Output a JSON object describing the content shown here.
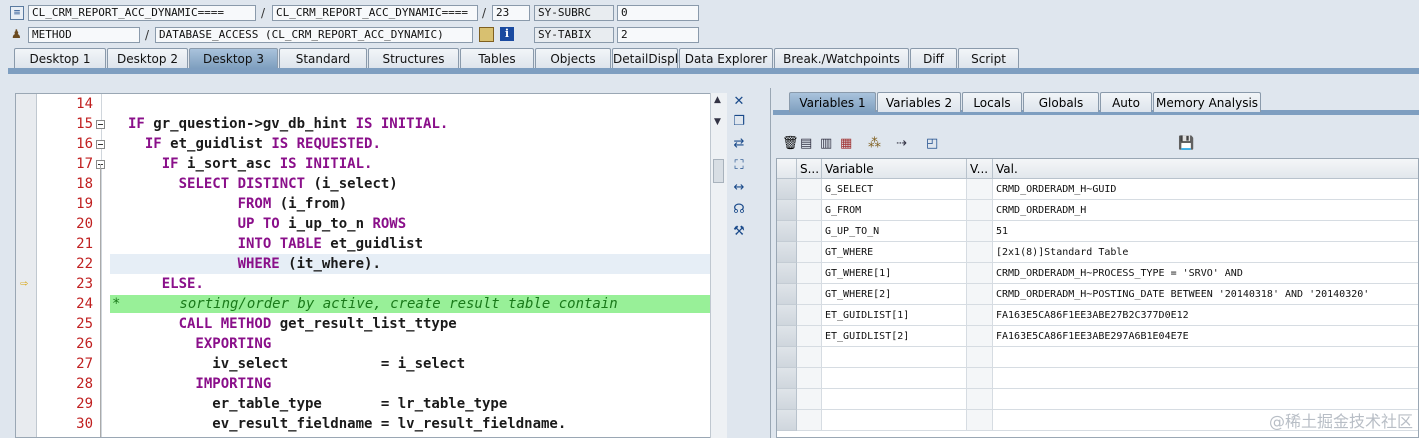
{
  "header": {
    "row1": {
      "class_name": "CL_CRM_REPORT_ACC_DYNAMIC====",
      "class_name2": "CL_CRM_REPORT_ACC_DYNAMIC====",
      "line": "23",
      "sysvar": "SY-SUBRC",
      "sysval": "0"
    },
    "row2": {
      "type": "METHOD",
      "method": "DATABASE_ACCESS (CL_CRM_REPORT_ACC_DYNAMIC)",
      "sysvar": "SY-TABIX",
      "sysval": "2"
    },
    "sep": "/"
  },
  "main_tabs": [
    "Desktop 1",
    "Desktop 2",
    "Desktop 3",
    "Standard",
    "Structures",
    "Tables",
    "Objects",
    "DetailDisplay",
    "Data Explorer",
    "Break./Watchpoints",
    "Diff",
    "Script"
  ],
  "var_tabs": [
    "Variables 1",
    "Variables 2",
    "Locals",
    "Globals",
    "Auto",
    "Memory Analysis"
  ],
  "code_lines": [
    {
      "n": "14",
      "parts": []
    },
    {
      "n": "15",
      "parts": [
        [
          "kw",
          "IF "
        ],
        [
          "id",
          "gr_question->gv_db_hint "
        ],
        [
          "kw",
          "IS INITIAL."
        ]
      ]
    },
    {
      "n": "16",
      "parts": [
        [
          "kw",
          "  IF "
        ],
        [
          "id",
          "et_guidlist "
        ],
        [
          "kw",
          "IS REQUESTED."
        ]
      ]
    },
    {
      "n": "17",
      "parts": [
        [
          "kw",
          "    IF "
        ],
        [
          "id",
          "i_sort_asc "
        ],
        [
          "kw",
          "IS INITIAL."
        ]
      ]
    },
    {
      "n": "18",
      "parts": [
        [
          "kw",
          "      SELECT DISTINCT "
        ],
        [
          "id",
          "(i_select)"
        ]
      ]
    },
    {
      "n": "19",
      "parts": [
        [
          "kw",
          "             FROM "
        ],
        [
          "id",
          "(i_from)"
        ]
      ]
    },
    {
      "n": "20",
      "parts": [
        [
          "kw",
          "             UP TO "
        ],
        [
          "id",
          "i_up_to_n "
        ],
        [
          "kw",
          "ROWS"
        ]
      ]
    },
    {
      "n": "21",
      "parts": [
        [
          "kw",
          "             INTO TABLE "
        ],
        [
          "id",
          "et_guidlist"
        ]
      ]
    },
    {
      "n": "22",
      "parts": [
        [
          "kw",
          "             WHERE "
        ],
        [
          "id",
          "(it_where)."
        ]
      ]
    },
    {
      "n": "23",
      "parts": [
        [
          "kw",
          "    ELSE."
        ]
      ]
    },
    {
      "n": "24",
      "parts": [
        [
          "cmt",
          "*       sorting/order by active, create result table contain"
        ]
      ]
    },
    {
      "n": "25",
      "parts": [
        [
          "kw",
          "      CALL METHOD "
        ],
        [
          "id",
          "get_result_list_ttype"
        ]
      ]
    },
    {
      "n": "26",
      "parts": [
        [
          "kw",
          "        EXPORTING"
        ]
      ]
    },
    {
      "n": "27",
      "parts": [
        [
          "id",
          "          iv_select           = i_select"
        ]
      ]
    },
    {
      "n": "28",
      "parts": [
        [
          "kw",
          "        IMPORTING"
        ]
      ]
    },
    {
      "n": "29",
      "parts": [
        [
          "id",
          "          er_table_type       = lr_table_type"
        ]
      ]
    },
    {
      "n": "30",
      "parts": [
        [
          "id",
          "          ev_result_fieldname = lv_result_fieldname."
        ]
      ]
    }
  ],
  "grid": {
    "headers": [
      "S...",
      "Variable",
      "V...",
      "Val."
    ],
    "rows": [
      {
        "var": "G_SELECT",
        "val": "CRMD_ORDERADM_H~GUID"
      },
      {
        "var": "G_FROM",
        "val": "CRMD_ORDERADM_H"
      },
      {
        "var": "G_UP_TO_N",
        "val": "51"
      },
      {
        "var": "GT_WHERE",
        "val": "[2x1(8)]Standard Table"
      },
      {
        "var": "GT_WHERE[1]",
        "val": "CRMD_ORDERADM_H~PROCESS_TYPE = 'SRVO' AND"
      },
      {
        "var": "GT_WHERE[2]",
        "val": "CRMD_ORDERADM_H~POSTING_DATE BETWEEN '20140318' AND '20140320'"
      },
      {
        "var": "ET_GUIDLIST[1]",
        "val": "FA163E5CA86F1EE3ABE27B2C377D0E12"
      },
      {
        "var": "ET_GUIDLIST[2]",
        "val": "FA163E5CA86F1EE3ABE297A6B1E04E7E"
      },
      {
        "var": "",
        "val": ""
      },
      {
        "var": "",
        "val": ""
      },
      {
        "var": "",
        "val": ""
      },
      {
        "var": "",
        "val": ""
      }
    ]
  },
  "watermark": "@稀土掘金技术社区",
  "colors": {
    "keyword": "#8a0f8a",
    "line_number": "#c02020",
    "comment_bg": "#98f098",
    "current_line_bg": "#e6eef6"
  }
}
